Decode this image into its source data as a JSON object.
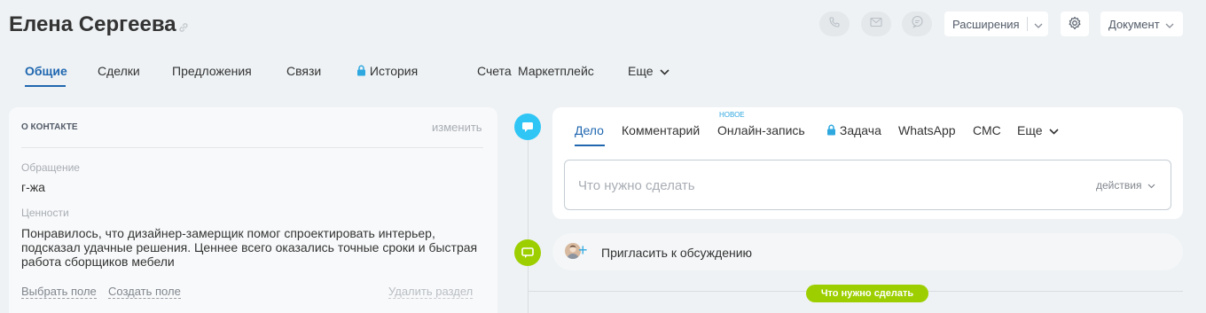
{
  "header": {
    "title": "Елена Сергеева",
    "extensions_label": "Расширения",
    "document_label": "Документ"
  },
  "tabs": [
    {
      "label": "Общие"
    },
    {
      "label": "Сделки"
    },
    {
      "label": "Предложения"
    },
    {
      "label": "Связи"
    },
    {
      "label": "История"
    },
    {
      "label": "Счета"
    },
    {
      "label": "Маркетплейс"
    },
    {
      "label": "Еще"
    }
  ],
  "contact": {
    "section_title": "О КОНТАКТЕ",
    "edit_label": "изменить",
    "field1_label": "Обращение",
    "field1_value": "г-жа",
    "field2_label": "Ценности",
    "field2_value": "Понравилось, что дизайнер-замерщик помог спроектировать интерьер, подсказал удачные решения. Ценнее всего оказались точные сроки и быстрая работа сборщиков мебели",
    "choose_field": "Выбрать поле",
    "create_field": "Создать поле",
    "delete_section": "Удалить раздел"
  },
  "editor": {
    "tabs": [
      {
        "label": "Дело"
      },
      {
        "label": "Комментарий"
      },
      {
        "label": "Онлайн-запись"
      },
      {
        "label": "Задача"
      },
      {
        "label": "WhatsApp"
      },
      {
        "label": "СМС"
      },
      {
        "label": "Еще"
      }
    ],
    "new_badge": "НОВОЕ",
    "placeholder": "Что нужно сделать",
    "actions_label": "действия"
  },
  "invite": {
    "label": "Пригласить к обсуждению"
  },
  "todo_pill": "Что нужно сделать",
  "colors": {
    "accent": "#2067b0",
    "timeline_blue": "#2fc6f6",
    "timeline_green": "#9dcf00"
  }
}
